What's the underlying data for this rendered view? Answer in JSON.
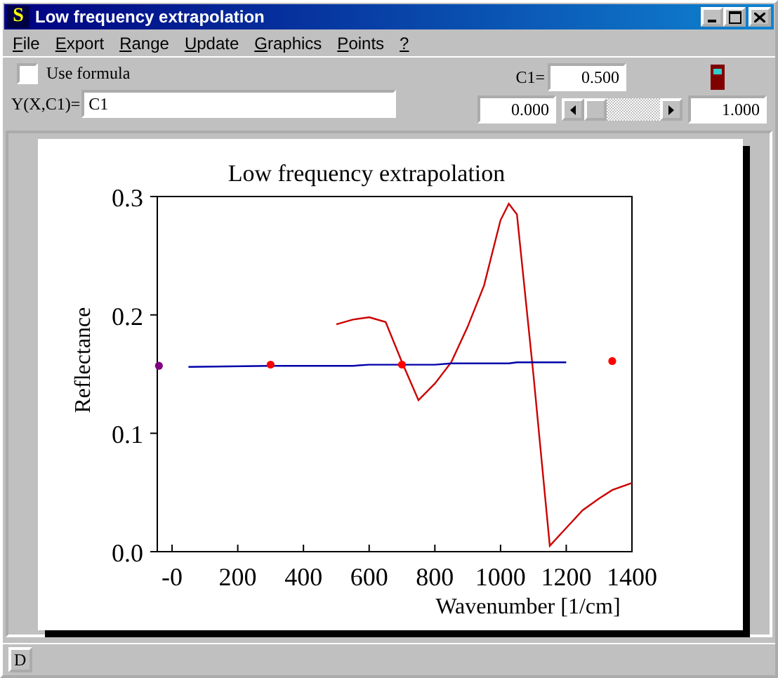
{
  "window": {
    "title": "Low frequency extrapolation",
    "app_icon": "S"
  },
  "menu": [
    {
      "label": "File"
    },
    {
      "label": "Export"
    },
    {
      "label": "Range"
    },
    {
      "label": "Update"
    },
    {
      "label": "Graphics"
    },
    {
      "label": "Points"
    },
    {
      "label": "?"
    }
  ],
  "toolbar": {
    "use_formula": {
      "label": "Use formula",
      "checked": false
    },
    "formula": {
      "label": "Y(X,C1)=",
      "value": "C1"
    },
    "c1": {
      "label": "C1=",
      "value": "0.500"
    },
    "min": "0.000",
    "max": "1.000"
  },
  "chart_data": {
    "type": "line",
    "title": "Low frequency extrapolation",
    "xlabel": "Wavenumber [1/cm]",
    "ylabel": "Reflectance",
    "xlim": [
      -45,
      1400
    ],
    "ylim": [
      0,
      0.3
    ],
    "xticks": [
      {
        "value": 0,
        "label": "-0"
      },
      200,
      400,
      600,
      800,
      1000,
      1200,
      1400
    ],
    "yticks": [
      {
        "value": 0,
        "label": "0.0"
      },
      {
        "value": 0.1,
        "label": "0.1"
      },
      {
        "value": 0.2,
        "label": "0.2"
      },
      {
        "value": 0.3,
        "label": "0.3"
      }
    ],
    "x": [
      -40,
      50,
      300,
      500,
      550,
      600,
      650,
      700,
      750,
      800,
      850,
      900,
      950,
      1000,
      1025,
      1050,
      1100,
      1150,
      1200,
      1250,
      1300,
      1340,
      1400
    ],
    "series": [
      {
        "color": "#cc0000",
        "values": [
          null,
          null,
          null,
          0.192,
          0.196,
          0.198,
          0.194,
          0.16,
          0.128,
          0.142,
          0.16,
          0.19,
          0.225,
          0.28,
          0.294,
          0.285,
          0.15,
          0.005,
          0.02,
          0.035,
          0.045,
          0.052,
          0.058
        ]
      },
      {
        "color": "#0000aa",
        "values": [
          null,
          0.156,
          0.157,
          0.157,
          0.157,
          0.158,
          0.158,
          0.158,
          0.158,
          0.158,
          0.159,
          0.159,
          0.159,
          0.159,
          0.159,
          0.16,
          0.16,
          0.16,
          0.16,
          null,
          null,
          null,
          null
        ]
      },
      {
        "type": "scatter",
        "marker": true,
        "color": "#ff0000",
        "values": [
          null,
          null,
          0.158,
          null,
          null,
          null,
          null,
          0.158,
          null,
          null,
          null,
          null,
          null,
          null,
          null,
          null,
          null,
          null,
          null,
          null,
          null,
          0.161,
          null
        ]
      },
      {
        "type": "scatter",
        "marker": true,
        "color": "#800080",
        "values": [
          0.157,
          null,
          null,
          null,
          null,
          null,
          null,
          null,
          null,
          null,
          null,
          null,
          null,
          null,
          null,
          null,
          null,
          null,
          null,
          null,
          null,
          null,
          null
        ]
      }
    ]
  },
  "status_bar": {
    "button": "D"
  }
}
